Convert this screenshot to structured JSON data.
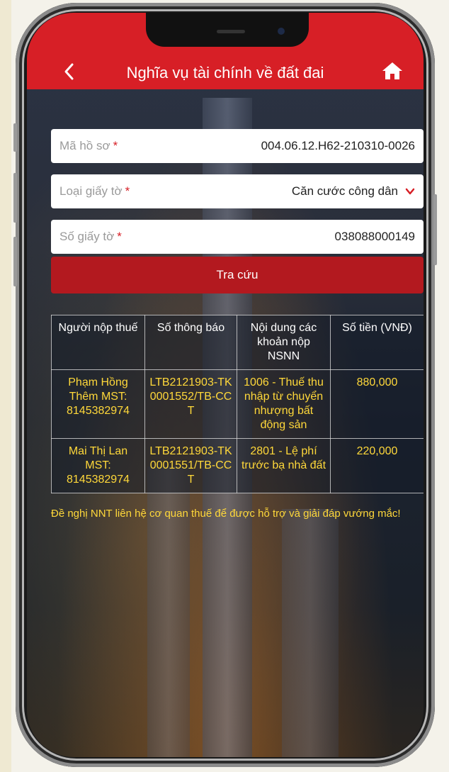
{
  "header": {
    "title": "Nghĩa vụ tài chính về đất đai"
  },
  "form": {
    "ho_so": {
      "label": "Mã hồ sơ",
      "required": "*",
      "value": "004.06.12.H62-210310-0026"
    },
    "loai_giay_to": {
      "label": "Loại giấy tờ",
      "required": "*",
      "value": "Căn cước công dân"
    },
    "so_giay_to": {
      "label": "Số giấy tờ",
      "required": "*",
      "value": "038088000149"
    },
    "search_button": "Tra cứu"
  },
  "table": {
    "headers": [
      "Người nộp thuế",
      "Số thông báo",
      "Nội dung các khoản nộp NSNN",
      "Số tiền (VNĐ)"
    ],
    "rows": [
      {
        "nguoi_nop": "Phạm Hồng Thêm MST: 8145382974",
        "so_thong_bao": "LTB2121903-TK0001552/TB-CCT",
        "noi_dung": "1006 - Thuế thu nhập từ chuyển nhượng bất động sản",
        "so_tien": "880,000"
      },
      {
        "nguoi_nop": "Mai Thị Lan MST: 8145382974",
        "so_thong_bao": "LTB2121903-TK0001551/TB-CCT",
        "noi_dung": "2801 - Lệ phí trước bạ nhà đất",
        "so_tien": "220,000"
      }
    ]
  },
  "note": "Đề nghị NNT liên hệ cơ quan thuế để được hỗ trợ và giải đáp vướng mắc!",
  "icons": {
    "back": "chevron-left-icon",
    "home": "home-icon",
    "dropdown": "chevron-down-icon"
  },
  "colors": {
    "brand_red": "#d71f26",
    "button_red": "#b3191f",
    "value_yellow": "#ffd83a"
  }
}
